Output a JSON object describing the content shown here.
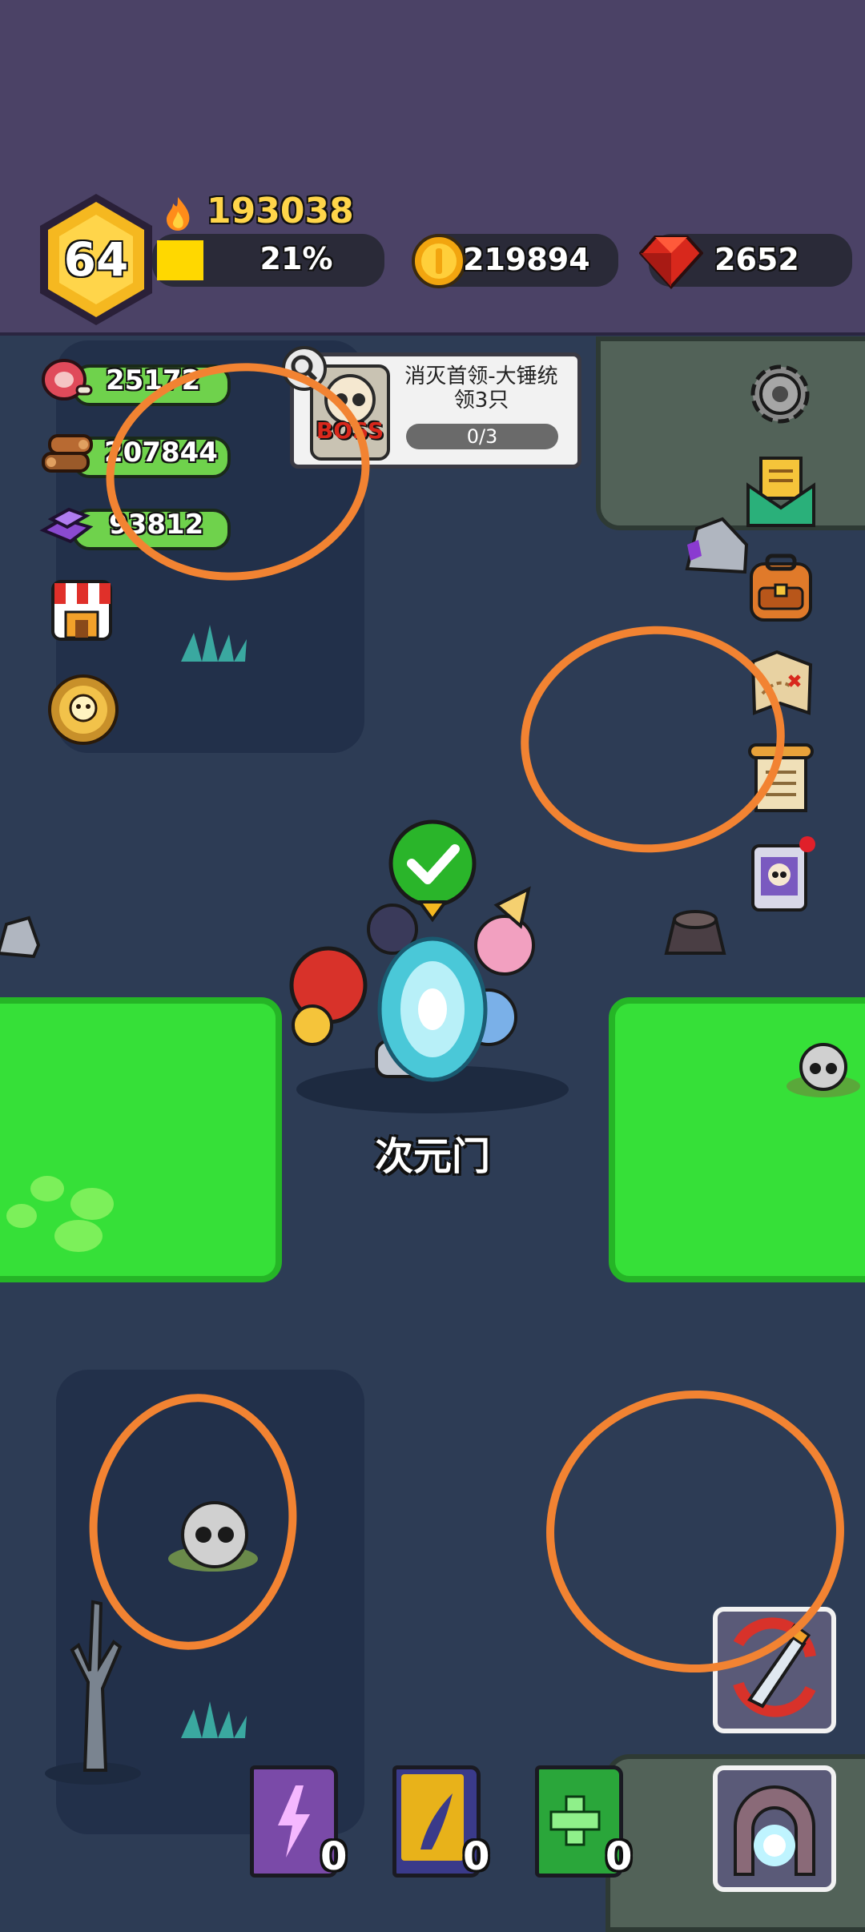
{
  "player": {
    "level": "64",
    "power": "193038",
    "xp_percent_label": "21%",
    "xp_fraction": 0.21
  },
  "currencies": {
    "gold": "219894",
    "gems": "2652"
  },
  "resources": {
    "meat": "25172",
    "wood": "207844",
    "ore": "93812"
  },
  "quest": {
    "title": "消灭首领-大锤统领3只",
    "badge": "BOSS",
    "progress": "0/3"
  },
  "portal": {
    "label": "次元门"
  },
  "skill_books": [
    {
      "name": "lightning-book",
      "count": "0",
      "color": "#7a4aa8"
    },
    {
      "name": "wind-book",
      "count": "0",
      "color": "#e8b21a"
    },
    {
      "name": "heal-book",
      "count": "0",
      "color": "#2aa63a"
    }
  ],
  "colors": {
    "accent_orange": "#f28332",
    "grass": "#36e038",
    "level_hex": "#f5b820"
  }
}
